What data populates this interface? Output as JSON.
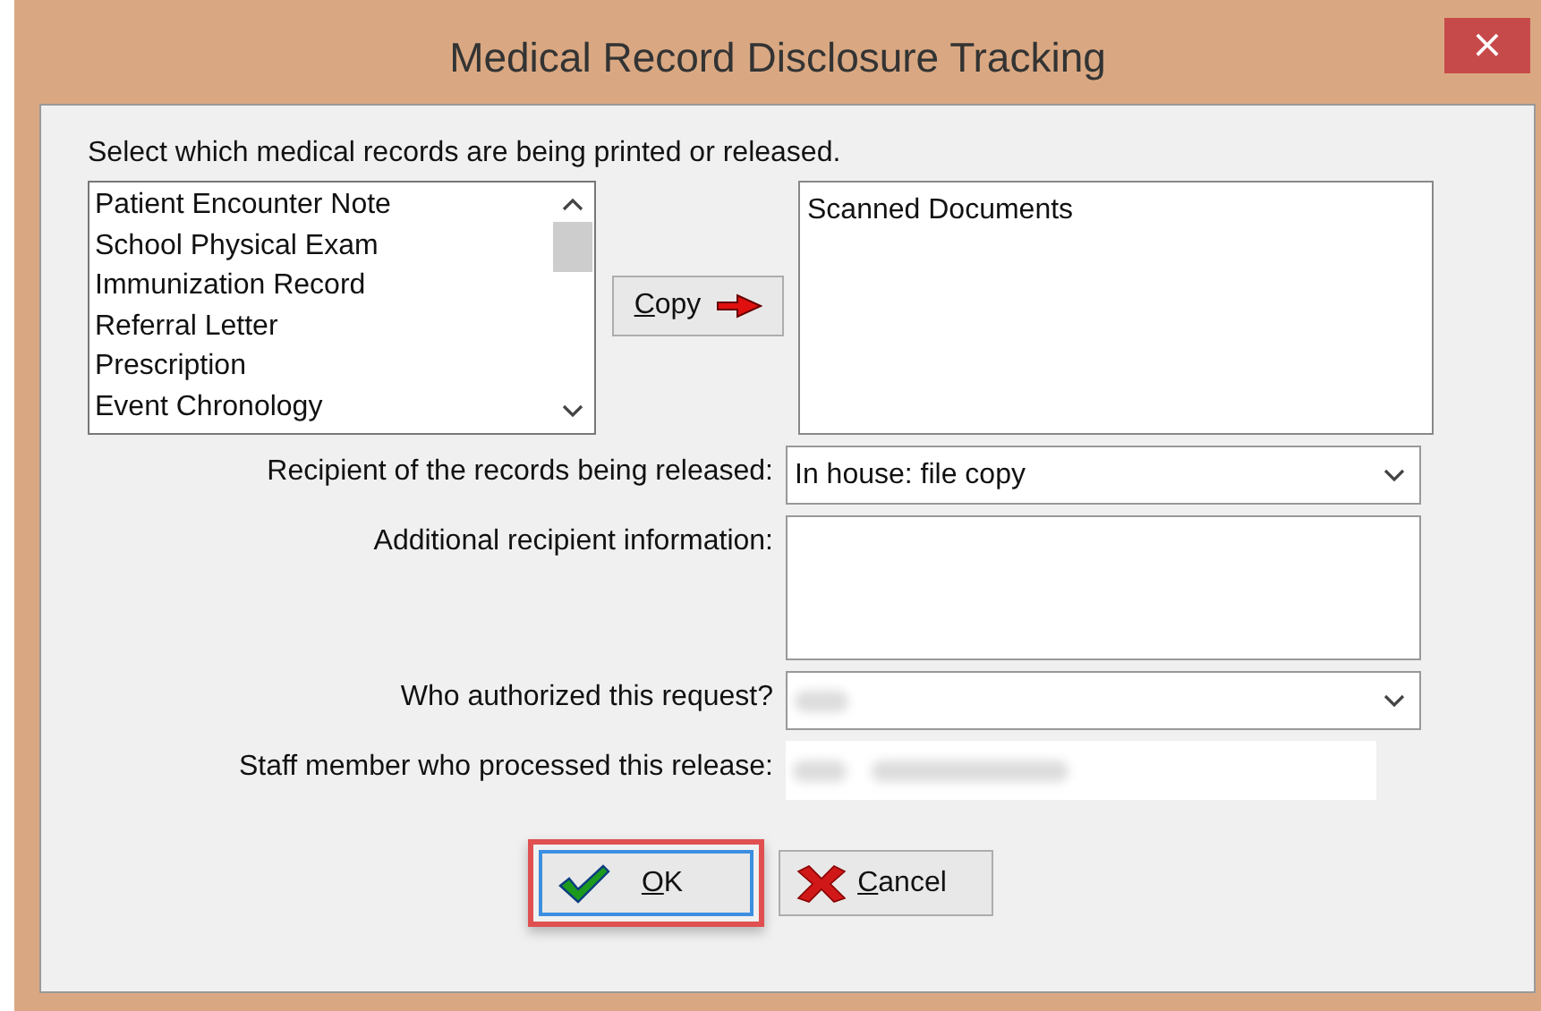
{
  "window": {
    "title": "Medical Record Disclosure Tracking",
    "close": "×"
  },
  "instruction": "Select which medical records are being printed or released.",
  "available_records": [
    {
      "label": "Patient Encounter Note"
    },
    {
      "label": "School Physical Exam"
    },
    {
      "label": "Immunization Record"
    },
    {
      "label": "Referral Letter"
    },
    {
      "label": "Prescription"
    },
    {
      "label": "Event Chronology"
    }
  ],
  "copy_button": {
    "label": "Copy",
    "underline_first": true
  },
  "selected_records": [
    {
      "label": "Scanned Documents"
    }
  ],
  "fields": [
    {
      "kind": "select",
      "label": "Recipient of the records being released:",
      "value": "In house: file copy"
    },
    {
      "kind": "textarea",
      "label": "Additional recipient information:"
    },
    {
      "kind": "select",
      "label": "Who authorized this request?",
      "redacted": true
    },
    {
      "kind": "readonly",
      "label": "Staff member who processed this release:",
      "redacted": true
    }
  ],
  "buttons": [
    {
      "kind": "ok",
      "label": "OK",
      "underline_first": true,
      "highlighted": true
    },
    {
      "kind": "cancel",
      "label": "Cancel",
      "underline_first": true,
      "highlighted": false
    }
  ]
}
